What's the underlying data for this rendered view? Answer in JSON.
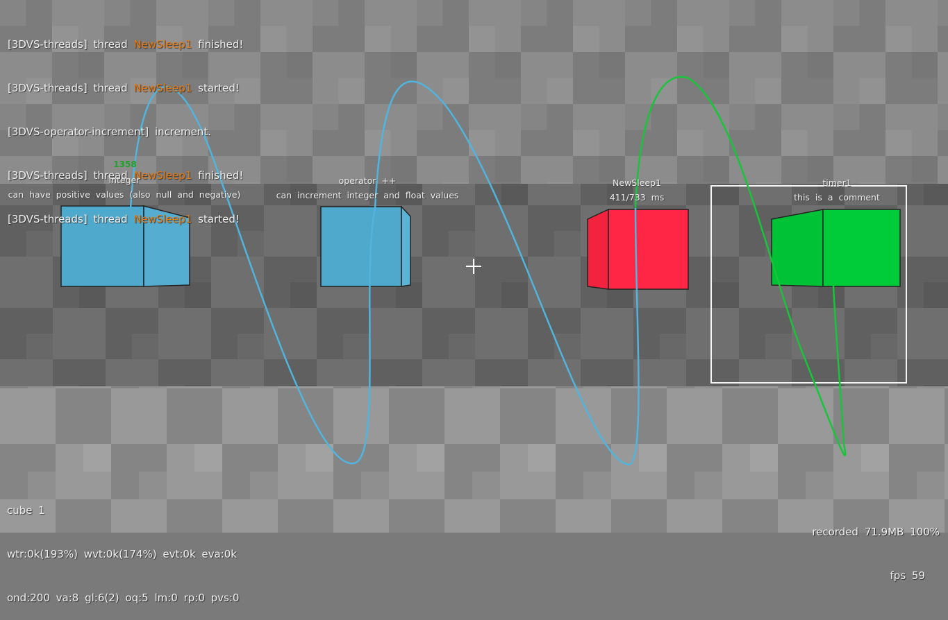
{
  "log": [
    {
      "tag": "[3DVS-threads]",
      "text": "thread",
      "name": "NewSleep1",
      "status": "finished!"
    },
    {
      "tag": "[3DVS-threads]",
      "text": "thread",
      "name": "NewSleep1",
      "status": "started!"
    },
    {
      "tag": "[3DVS-operator-increment]",
      "text": "increment.",
      "name": "",
      "status": ""
    },
    {
      "tag": "[3DVS-threads]",
      "text": "thread",
      "name": "NewSleep1",
      "status": "finished!"
    },
    {
      "tag": "[3DVS-threads]",
      "text": "thread",
      "name": "NewSleep1",
      "status": "started!"
    }
  ],
  "nodes": {
    "integer": {
      "value": "1358",
      "title": "integer",
      "comment": "can have positive values (also null and negative)",
      "color": "#4fa9cd"
    },
    "operator": {
      "title": "operator ++",
      "comment": "can increment integer and float values",
      "color": "#4fa9cd"
    },
    "sleep": {
      "title": "NewSleep1",
      "comment": "411/733 ms",
      "color": "#fe2545"
    },
    "timer": {
      "title": "timer1",
      "comment": "this is a comment",
      "color": "#00cc3a"
    }
  },
  "stats": {
    "line1": "cube 1",
    "line2": "wtr:0k(193%) wvt:0k(174%) evt:0k eva:0k",
    "line3": "ond:200 va:8 gl:6(2) oq:5 lm:0 rp:0 pvs:0"
  },
  "status": {
    "recorded": "recorded 71.9MB 100%",
    "fps": "fps 59"
  },
  "colors": {
    "wire_blue": "#52b4dd",
    "wire_green": "#19c43a",
    "log_highlight": "#e87a10"
  }
}
